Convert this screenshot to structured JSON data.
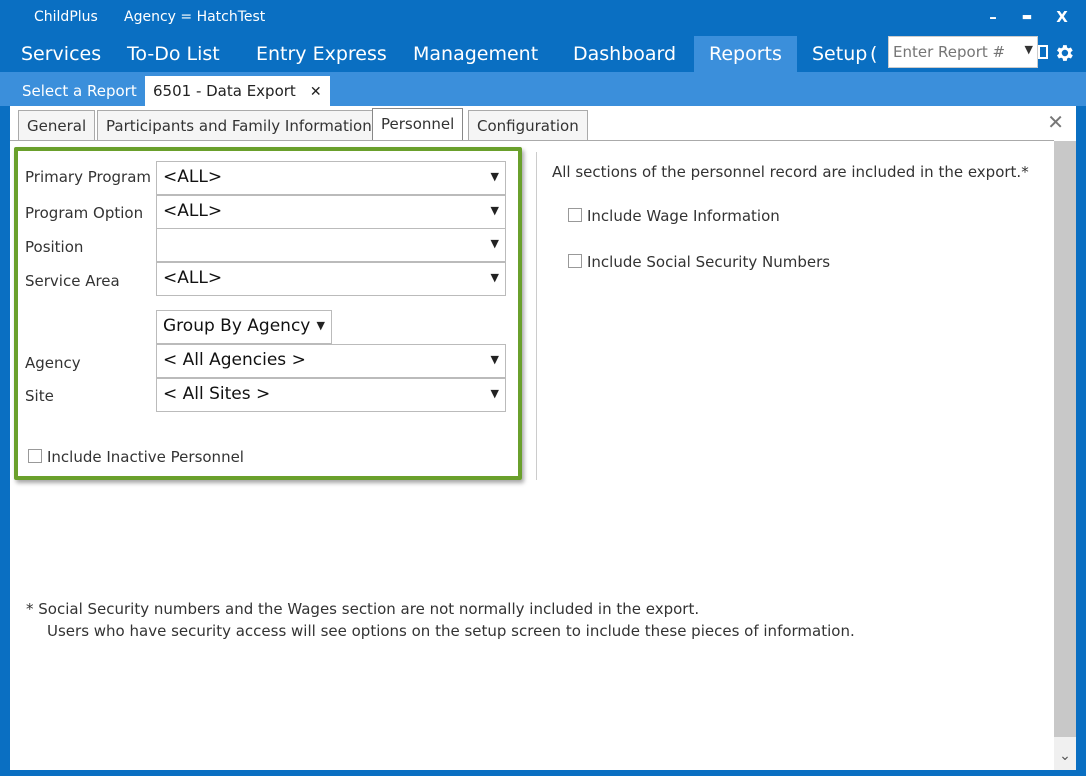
{
  "titlebar": {
    "app_name": "ChildPlus",
    "agency": "Agency = HatchTest",
    "minimize": "–",
    "maximize": "▬",
    "close": "X"
  },
  "menu": {
    "items": [
      {
        "label": "Services"
      },
      {
        "label": "To-Do List"
      },
      {
        "label": "Entry Express"
      },
      {
        "label": "Management"
      },
      {
        "label": "Dashboard"
      },
      {
        "label": "Reports"
      },
      {
        "label": "Setup"
      }
    ],
    "active": "Reports",
    "overflow_glyph": "(",
    "report_entry_placeholder": "Enter Report #"
  },
  "icons": {
    "print": "print-icon",
    "gear": "gear-icon",
    "dropdown": "chevron-down-icon"
  },
  "doc_tabs": {
    "select_report": "Select a Report",
    "data_export": "6501 - Data Export",
    "close_glyph": "✕"
  },
  "sub_tabs": [
    {
      "label": "General"
    },
    {
      "label": "Participants and Family Information"
    },
    {
      "label": "Personnel"
    },
    {
      "label": "Configuration"
    }
  ],
  "active_sub_tab": "Personnel",
  "filters": {
    "primary_program": {
      "label": "Primary Program",
      "value": "<ALL>"
    },
    "program_option": {
      "label": "Program Option",
      "value": "<ALL>"
    },
    "position": {
      "label": "Position",
      "value": ""
    },
    "service_area": {
      "label": "Service Area",
      "value": "<ALL>"
    },
    "group_by": {
      "value": "Group By Agency"
    },
    "agency": {
      "label": "Agency",
      "value": "< All Agencies >"
    },
    "site": {
      "label": "Site",
      "value": "< All Sites >"
    },
    "include_inactive": {
      "label": "Include Inactive Personnel",
      "checked": false
    }
  },
  "options": {
    "info_text": "All sections of the personnel record are included in the export.*",
    "include_wage": {
      "label": "Include Wage Information",
      "checked": false
    },
    "include_ssn": {
      "label": "Include Social Security Numbers",
      "checked": false
    }
  },
  "footnote": {
    "line1": "*  Social Security numbers and the Wages section are not normally included in the export.",
    "line2": "Users who have security access will see options on the setup screen to include these pieces of information."
  },
  "colors": {
    "title_blue": "#0a6fc2",
    "tab_blue": "#3b8fdb",
    "highlight_green": "#6aa02c"
  },
  "content_close_glyph": "✕",
  "scroll_down_glyph": "⌄"
}
